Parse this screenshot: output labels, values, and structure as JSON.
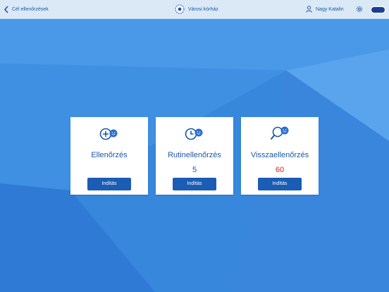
{
  "header": {
    "back_label": "Cél ellenőrzések",
    "hospital_name": "Városi kórház",
    "user_name": "Nagy Katalin"
  },
  "cards": [
    {
      "title": "Ellenőrzés",
      "count": "",
      "button": "Indítás",
      "icon": "plus-smiley-icon"
    },
    {
      "title": "Rutinellenőrzés",
      "count": "5",
      "button": "Indítás",
      "icon": "clock-smiley-icon"
    },
    {
      "title": "Visszaellenőrzés",
      "count": "60",
      "button": "Indítás",
      "icon": "magnifier-smiley-icon"
    }
  ],
  "colors": {
    "accent": "#1b5cb4",
    "text": "#1c57a8",
    "alert": "#e02020",
    "header_bg": "#dbe9f7"
  }
}
